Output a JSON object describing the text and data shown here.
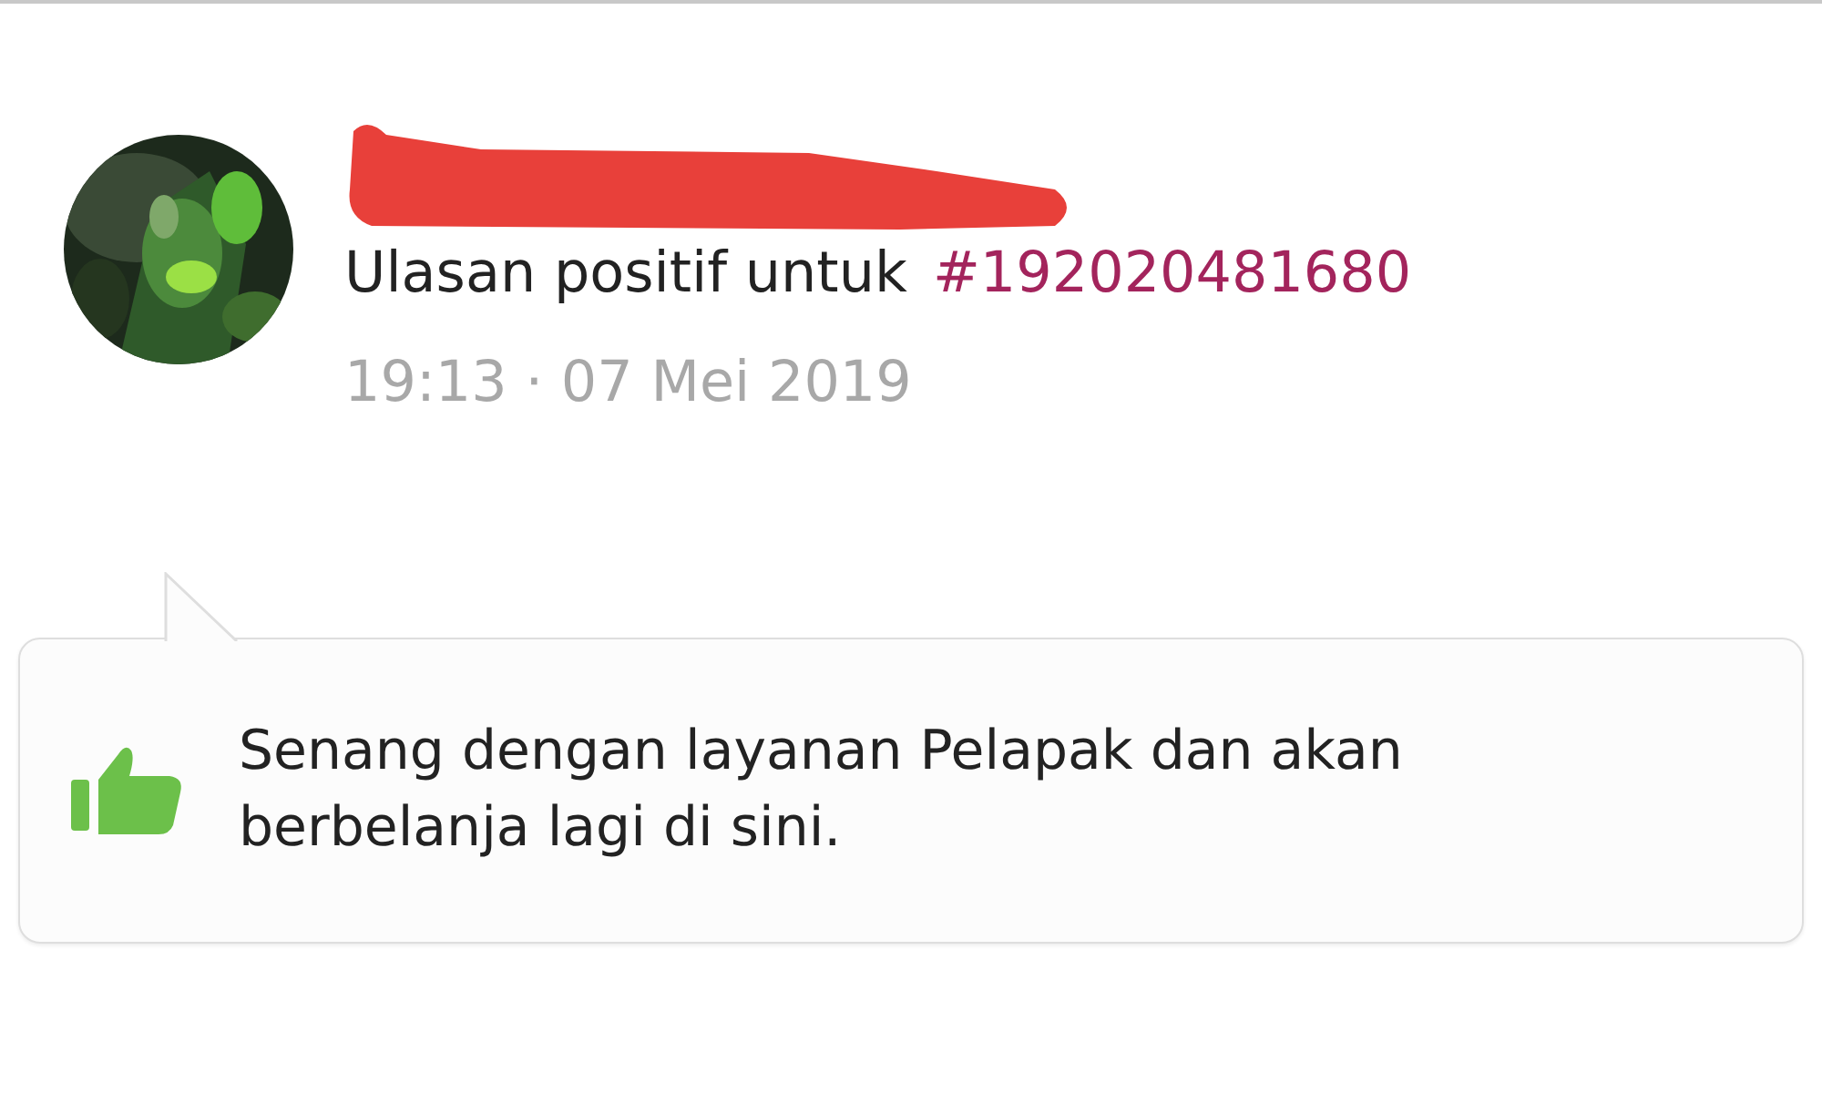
{
  "review": {
    "title": "Ulasan positif untuk",
    "invoice": "#192020481680",
    "time": "19:13 · 07 Mei 2019"
  },
  "comment": {
    "liked": true,
    "text": "Senang dengan layanan Pelapak dan akan berbelanja lagi di sini."
  }
}
